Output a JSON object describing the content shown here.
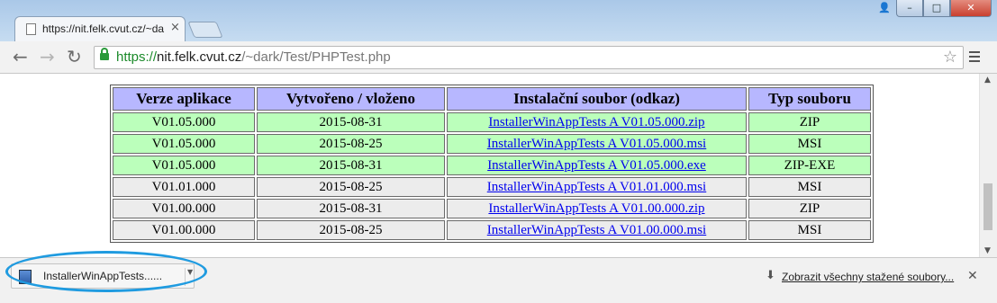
{
  "browser": {
    "tab_title": "https://nit.felk.cvut.cz/~da",
    "tab_close": "×",
    "window_buttons": {
      "user": "👤",
      "minimize": "–",
      "maximize": "□",
      "close": "✕"
    }
  },
  "toolbar": {
    "back": "←",
    "forward": "→",
    "reload": "↻",
    "url_scheme": "https://",
    "url_host": "nit.felk.cvut.cz",
    "url_path": "/~dark/Test/PHPTest.php",
    "star": "☆"
  },
  "table": {
    "headers": [
      "Verze aplikace",
      "Vytvořeno / vloženo",
      "Instalační soubor (odkaz)",
      "Typ souboru"
    ],
    "rows": [
      {
        "version": "V01.05.000",
        "date": "2015-08-31",
        "file": "InstallerWinAppTests A V01.05.000.zip",
        "type": "ZIP",
        "highlight": true
      },
      {
        "version": "V01.05.000",
        "date": "2015-08-25",
        "file": "InstallerWinAppTests A V01.05.000.msi",
        "type": "MSI",
        "highlight": true
      },
      {
        "version": "V01.05.000",
        "date": "2015-08-31",
        "file": "InstallerWinAppTests A V01.05.000.exe",
        "type": "ZIP-EXE",
        "highlight": true
      },
      {
        "version": "V01.01.000",
        "date": "2015-08-25",
        "file": "InstallerWinAppTests A V01.01.000.msi",
        "type": "MSI",
        "highlight": false
      },
      {
        "version": "V01.00.000",
        "date": "2015-08-31",
        "file": "InstallerWinAppTests A V01.00.000.zip",
        "type": "ZIP",
        "highlight": false
      },
      {
        "version": "V01.00.000",
        "date": "2015-08-25",
        "file": "InstallerWinAppTests A V01.00.000.msi",
        "type": "MSI",
        "highlight": false
      }
    ]
  },
  "download_shelf": {
    "item_name": "InstallerWinAppTests......",
    "item_icon": "installer-icon",
    "show_all_label": "Zobrazit všechny stažené soubory...",
    "close": "✕"
  },
  "colors": {
    "header_bg": "#b7b7ff",
    "new_row_bg": "#bbffbb",
    "old_row_bg": "#ececec",
    "highlight_ring": "#1f9be0"
  }
}
